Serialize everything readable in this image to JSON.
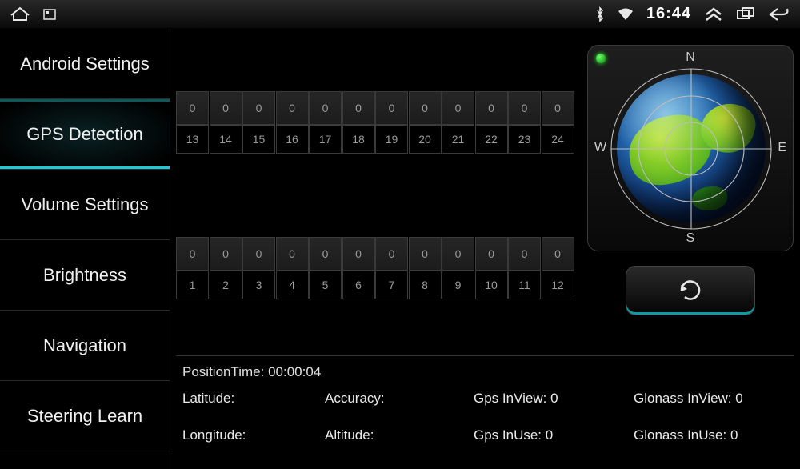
{
  "statusbar": {
    "time": "16:44"
  },
  "sidebar": {
    "items": [
      {
        "label": "Android Settings",
        "active": false
      },
      {
        "label": "GPS Detection",
        "active": true
      },
      {
        "label": "Volume Settings",
        "active": false
      },
      {
        "label": "Brightness",
        "active": false
      },
      {
        "label": "Navigation",
        "active": false
      },
      {
        "label": "Steering Learn",
        "active": false
      }
    ]
  },
  "satellites": {
    "block1": {
      "signal": [
        "0",
        "0",
        "0",
        "0",
        "0",
        "0",
        "0",
        "0",
        "0",
        "0",
        "0",
        "0"
      ],
      "id": [
        "13",
        "14",
        "15",
        "16",
        "17",
        "18",
        "19",
        "20",
        "21",
        "22",
        "23",
        "24"
      ]
    },
    "block2": {
      "signal": [
        "0",
        "0",
        "0",
        "0",
        "0",
        "0",
        "0",
        "0",
        "0",
        "0",
        "0",
        "0"
      ],
      "id": [
        "1",
        "2",
        "3",
        "4",
        "5",
        "6",
        "7",
        "8",
        "9",
        "10",
        "11",
        "12"
      ]
    }
  },
  "compass": {
    "n": "N",
    "s": "S",
    "e": "E",
    "w": "W"
  },
  "info": {
    "position_time_label": "PositionTime:",
    "position_time_value": "00:00:04",
    "latitude_label": "Latitude:",
    "latitude_value": "",
    "longitude_label": "Longitude:",
    "longitude_value": "",
    "accuracy_label": "Accuracy:",
    "accuracy_value": "",
    "altitude_label": "Altitude:",
    "altitude_value": "",
    "gps_inview_label": "Gps InView:",
    "gps_inview_value": "0",
    "gps_inuse_label": "Gps InUse:",
    "gps_inuse_value": "0",
    "glonass_inview_label": "Glonass InView:",
    "glonass_inview_value": "0",
    "glonass_inuse_label": "Glonass InUse:",
    "glonass_inuse_value": "0"
  }
}
